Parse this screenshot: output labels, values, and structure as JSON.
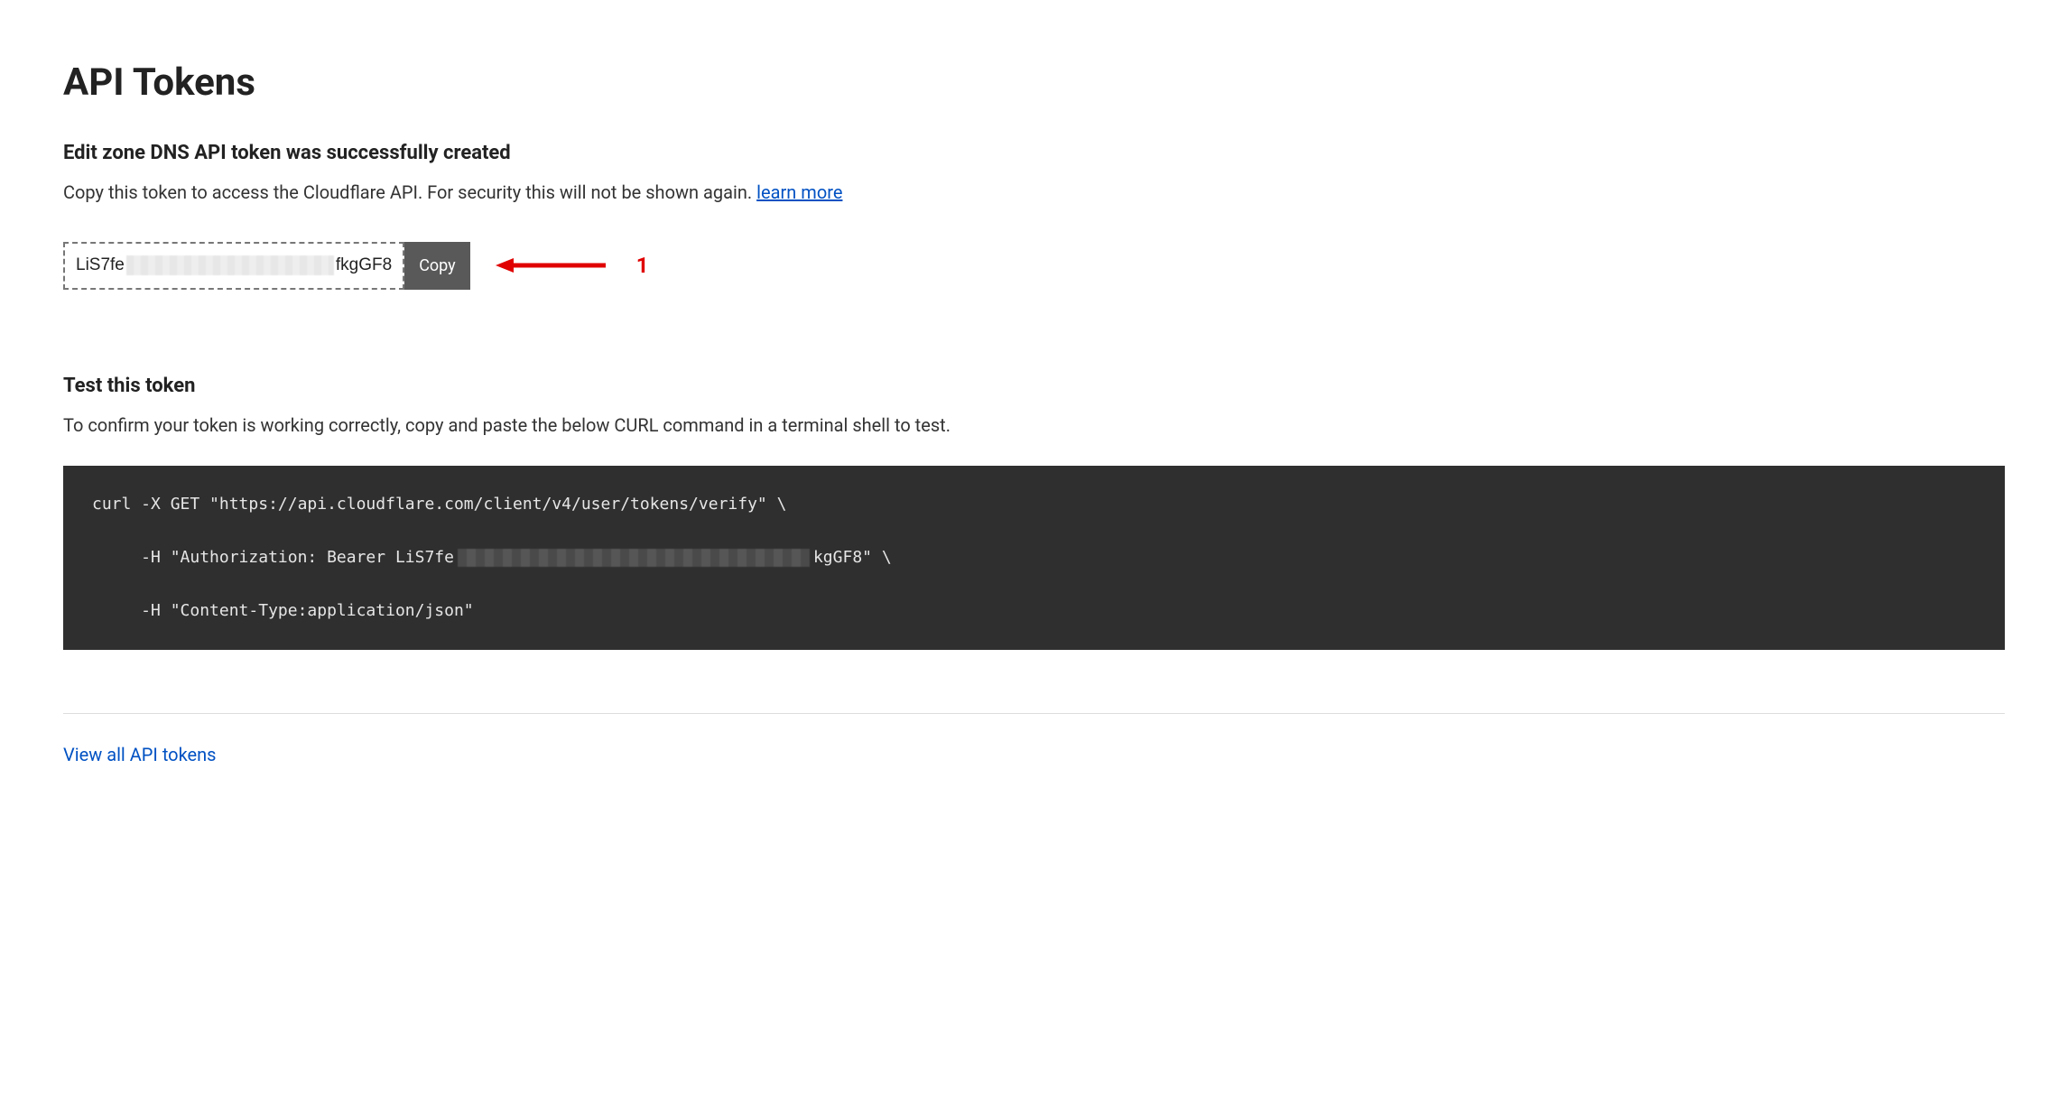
{
  "page": {
    "title": "API Tokens",
    "success_heading": "Edit zone DNS API token was successfully created",
    "copy_instruction": "Copy this token to access the Cloudflare API. For security this will not be shown again. ",
    "learn_more": "learn more"
  },
  "token": {
    "prefix": "LiS7fe",
    "suffix": "fkgGF8",
    "copy_label": "Copy"
  },
  "annotation": {
    "label": "1"
  },
  "test": {
    "heading": "Test this token",
    "description": "To confirm your token is working correctly, copy and paste the below CURL command in a terminal shell to test.",
    "curl": {
      "line1": "curl -X GET \"https://api.cloudflare.com/client/v4/user/tokens/verify\" \\",
      "line2_pre": "     -H \"Authorization: Bearer LiS7fe",
      "line2_post": "kgGF8\" \\",
      "line3": "     -H \"Content-Type:application/json\""
    }
  },
  "footer": {
    "view_all": "View all API tokens"
  }
}
